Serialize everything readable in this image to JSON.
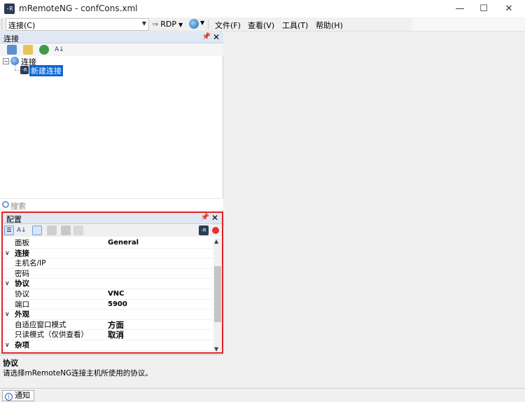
{
  "window": {
    "title": "mRemoteNG - confCons.xml",
    "app_icon": "mremoteng-icon",
    "controls": {
      "minimize": "—",
      "maximize": "☐",
      "close": "✕"
    }
  },
  "toolbar": {
    "connection_combo": "连接(C)",
    "protocol_label": "RDP",
    "menus": [
      {
        "label": "文件(F)"
      },
      {
        "label": "查看(V)"
      },
      {
        "label": "工具(T)"
      },
      {
        "label": "帮助(H)"
      }
    ]
  },
  "connections_panel": {
    "title": "连接",
    "tree": {
      "root_label": "连接",
      "child_label": "新建连接"
    },
    "search_placeholder": "搜索"
  },
  "config_panel": {
    "title": "配置",
    "rows": [
      {
        "type": "prop",
        "name": "面板",
        "value": "General"
      },
      {
        "type": "cat",
        "name": "连接"
      },
      {
        "type": "prop",
        "name": "主机名/IP",
        "value": ""
      },
      {
        "type": "prop",
        "name": "密码",
        "value": ""
      },
      {
        "type": "cat",
        "name": "协议"
      },
      {
        "type": "prop",
        "name": "协议",
        "value": "VNC"
      },
      {
        "type": "prop",
        "name": "端口",
        "value": "5900"
      },
      {
        "type": "cat",
        "name": "外观"
      },
      {
        "type": "prop",
        "name": "自适应窗口模式",
        "value": "方面"
      },
      {
        "type": "prop",
        "name": "只读模式（仅供查看）",
        "value": "取消"
      },
      {
        "type": "cat",
        "name": "杂项"
      }
    ]
  },
  "help": {
    "title": "协议",
    "description": "请选择mRemoteNG连接主机所使用的协议。"
  },
  "statusbar": {
    "notify_tab": "通知"
  },
  "colors": {
    "panel_header": "#dfe8f3",
    "selection": "#0a64d6",
    "highlight_border": "#e02424",
    "record_button": "#e53030"
  }
}
